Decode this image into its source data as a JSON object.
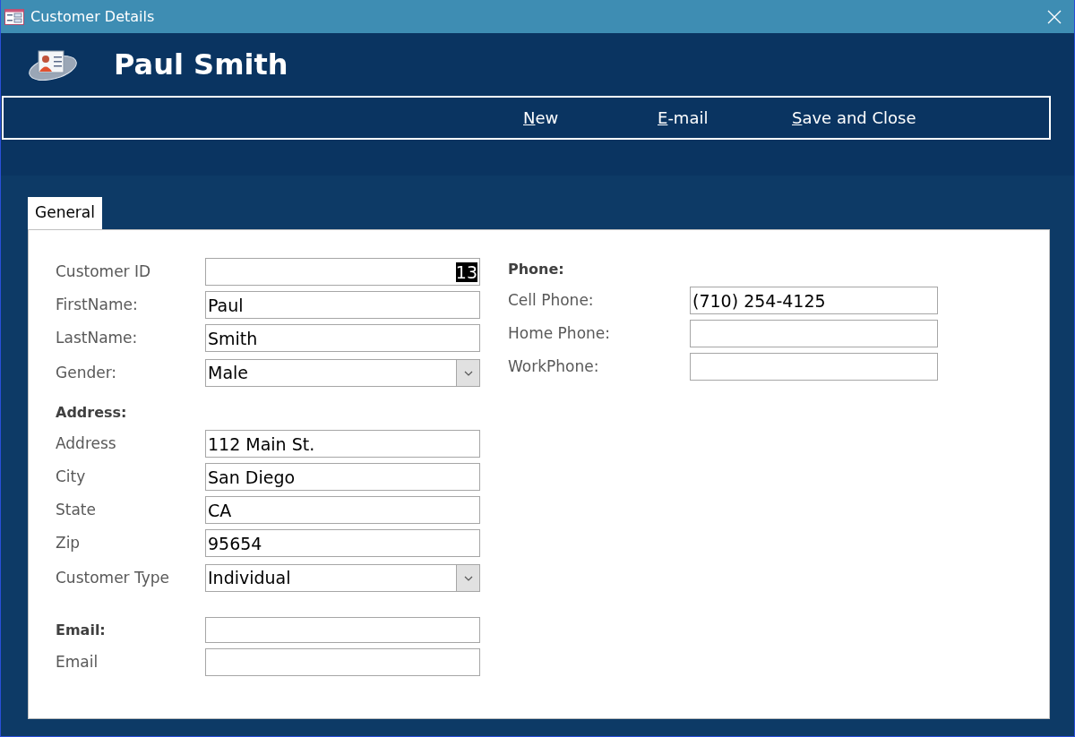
{
  "window": {
    "title": "Customer Details"
  },
  "header": {
    "title": "Paul Smith"
  },
  "toolbar": [
    {
      "key": "N",
      "rest": "ew"
    },
    {
      "key": "E",
      "rest": "-mail"
    },
    {
      "key": "S",
      "rest": "ave and Close"
    }
  ],
  "tabs": [
    {
      "label": "General",
      "selected": true
    }
  ],
  "left_fields": [
    {
      "kind": "number",
      "label": "Customer ID",
      "value": "13",
      "highlighted": true
    },
    {
      "kind": "text",
      "label": "FirstName:",
      "value": "Paul"
    },
    {
      "kind": "text",
      "label": "LastName:",
      "value": "Smith"
    },
    {
      "kind": "combo",
      "label": "Gender:",
      "value": "Male"
    },
    {
      "kind": "heading",
      "label": "Address:"
    },
    {
      "kind": "text",
      "label": "Address",
      "value": "112 Main St."
    },
    {
      "kind": "text",
      "label": "City",
      "value": "San Diego"
    },
    {
      "kind": "text",
      "label": "State",
      "value": "CA"
    },
    {
      "kind": "text",
      "label": "Zip",
      "value": "95654"
    },
    {
      "kind": "combo",
      "label": "Customer Type",
      "value": "Individual"
    },
    {
      "kind": "heading-field",
      "label": "Email:"
    },
    {
      "kind": "text",
      "label": "Email"
    }
  ],
  "right_fields": [
    {
      "kind": "heading",
      "label": "Phone:"
    },
    {
      "kind": "text",
      "label": "Cell Phone:",
      "value": "(710) 254-4125"
    },
    {
      "kind": "text",
      "label": "Home Phone:"
    },
    {
      "kind": "text",
      "label": "WorkPhone:"
    }
  ]
}
